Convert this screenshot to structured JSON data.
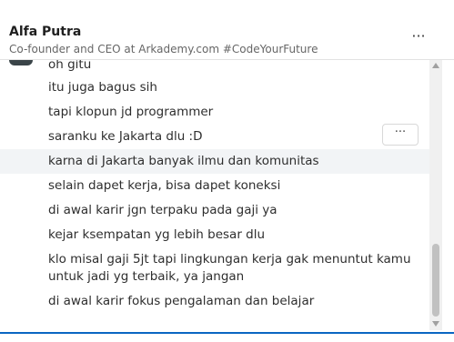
{
  "header": {
    "name": "Alfa Putra",
    "headline": "Co-founder and CEO at Arkademy.com #CodeYourFuture",
    "more_label": "···"
  },
  "messages": [
    {
      "text": "oh gitu"
    },
    {
      "text": "itu juga bagus sih"
    },
    {
      "text": "tapi klopun jd programmer"
    },
    {
      "text": "saranku ke Jakarta dlu :D"
    },
    {
      "text": "karna di Jakarta banyak ilmu dan komunitas"
    },
    {
      "text": "selain dapet kerja, bisa dapet koneksi"
    },
    {
      "text": "di awal karir jgn terpaku pada gaji ya"
    },
    {
      "text": "kejar ksempatan yg lebih besar dlu"
    },
    {
      "text": "klo misal gaji 5jt tapi lingkungan kerja gak menuntut kamu untuk jadi yg terbaik, ya jangan"
    },
    {
      "text": "di awal karir fokus pengalaman dan belajar"
    }
  ],
  "message_more_label": "···",
  "icons": {
    "header_more": "more-horizontal-icon",
    "message_more": "more-horizontal-icon",
    "scroll_up": "triangle-up-icon",
    "scroll_down": "triangle-down-icon"
  },
  "colors": {
    "accent": "#0a66c2",
    "hover_row": "#f2f4f6",
    "header_text": "#1f1f1f",
    "subtext": "#666666"
  }
}
